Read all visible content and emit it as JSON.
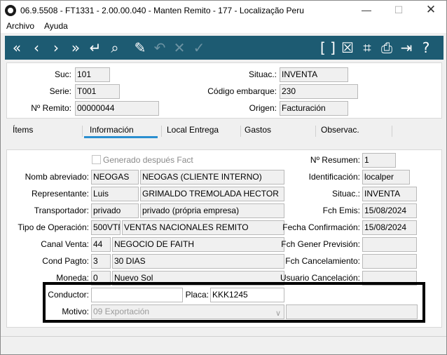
{
  "window": {
    "title": "06.9.5508 - FT1331 - 2.00.00.040 - Manten Remito - 177 - Localização Peru",
    "minimize": "—",
    "maximize": "☐",
    "close": "✕"
  },
  "menu": {
    "items": [
      "Archivo",
      "Ayuda"
    ]
  },
  "toolbar": {
    "first": "«",
    "prev": "‹",
    "next": "›",
    "last": "»",
    "enter": "↵",
    "search": "⌕",
    "edit": "✎",
    "undo": "↶",
    "cancel": "✕",
    "confirm": "✓",
    "brackets": "[ ]",
    "close_box": "☒",
    "tree": "⌗",
    "print": "⎙",
    "exit": "⇥",
    "help": "?"
  },
  "header": {
    "suc_label": "Suc:",
    "suc_value": "101",
    "serie_label": "Serie:",
    "serie_value": "T001",
    "remito_label": "Nº Remito:",
    "remito_value": "00000044",
    "situac_label": "Situac.:",
    "situac_value": "INVENTA",
    "embarque_label": "Código embarque:",
    "embarque_value": "230",
    "origen_label": "Origen:",
    "origen_value": "Facturación"
  },
  "tabs": [
    "Ítems",
    "Información",
    "Local Entrega",
    "Gastos",
    "Observac."
  ],
  "info": {
    "generado_label": "Generado después Fact",
    "nomb_label": "Nomb abreviado:",
    "nomb_code": "NEOGAS",
    "nomb_desc": "NEOGAS (CLIENTE INTERNO)",
    "rep_label": "Representante:",
    "rep_code": "Luis",
    "rep_desc": "GRIMALDO TREMOLADA HECTOR",
    "trans_label": "Transportador:",
    "trans_code": "privado",
    "trans_desc": "privado (própria empresa)",
    "tipo_label": "Tipo de Operación:",
    "tipo_code": "500VTR",
    "tipo_desc": "VENTAS NACIONALES REMITO",
    "canal_label": "Canal Venta:",
    "canal_code": "44",
    "canal_desc": "NEGOCIO DE FAITH",
    "cond_label": "Cond Pagto:",
    "cond_code": "3",
    "cond_desc": "30 DIAS",
    "moneda_label": "Moneda:",
    "moneda_code": "0",
    "moneda_desc": "Nuevo Sol",
    "resumen_label": "Nº Resumen:",
    "resumen_value": "1",
    "ident_label": "Identificación:",
    "ident_value": "localper",
    "situac_label": "Situac.:",
    "situac_value": "INVENTA",
    "emis_label": "Fch Emis:",
    "emis_value": "15/08/2024",
    "confirm_label": "Fecha Confirmación:",
    "confirm_value": "15/08/2024",
    "prevision_label": "Fch Gener Previsión:",
    "prevision_value": "",
    "cancel_label": "Fch Cancelamiento:",
    "cancel_value": "",
    "usuario_label": "Usuario Cancelación:",
    "usuario_value": "",
    "conductor_label": "Conductor:",
    "conductor_value": "",
    "placa_label": "Placa:",
    "placa_value": "KKK1245",
    "motivo_label": "Motivo:",
    "motivo_value": "09 Exportación",
    "motivo_extra": ""
  },
  "colors": {
    "toolbar": "#1d5b72",
    "tab_accent": "#2a8fd0",
    "highlight_border": "#000000"
  }
}
